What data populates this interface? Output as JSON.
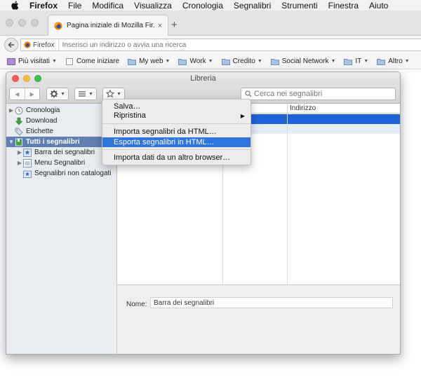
{
  "menubar": {
    "items": [
      "Firefox",
      "File",
      "Modifica",
      "Visualizza",
      "Cronologia",
      "Segnalibri",
      "Strumenti",
      "Finestra",
      "Aiuto"
    ]
  },
  "browser": {
    "tab_title": "Pagina iniziale di Mozilla Fir...",
    "tab_close": "×",
    "new_tab": "+",
    "identity_label": "Firefox",
    "url_placeholder": "Inserisci un indirizzo o avvia una ricerca"
  },
  "bookmarks_toolbar": {
    "items": [
      {
        "label": "Più visitati",
        "icon": "most-visited-icon",
        "dropdown": true
      },
      {
        "label": "Come iniziare",
        "icon": "page-icon",
        "dropdown": false
      },
      {
        "label": "My web",
        "icon": "folder-icon",
        "dropdown": true
      },
      {
        "label": "Work",
        "icon": "folder-icon",
        "dropdown": true
      },
      {
        "label": "Credito",
        "icon": "folder-icon",
        "dropdown": true
      },
      {
        "label": "Social Network",
        "icon": "folder-icon",
        "dropdown": true
      },
      {
        "label": "IT",
        "icon": "folder-icon",
        "dropdown": true
      },
      {
        "label": "Altro",
        "icon": "folder-icon",
        "dropdown": true
      }
    ]
  },
  "library": {
    "title": "Libreria",
    "search_placeholder": "Cerca nei segnalibri",
    "sidebar": {
      "items": [
        {
          "label": "Cronologia",
          "icon": "history-clock-icon",
          "twisty": "▶",
          "indent": 0
        },
        {
          "label": "Download",
          "icon": "download-arrow-icon",
          "twisty": "",
          "indent": 0
        },
        {
          "label": "Etichette",
          "icon": "tag-icon",
          "twisty": "",
          "indent": 0
        },
        {
          "label": "Tutti i segnalibri",
          "icon": "bookmark-folder-icon",
          "twisty": "▼",
          "indent": 0,
          "selected": true
        },
        {
          "label": "Barra dei segnalibri",
          "icon": "star-toolbar-icon",
          "twisty": "▶",
          "indent": 1
        },
        {
          "label": "Menu Segnalibri",
          "icon": "bookmarks-menu-icon",
          "twisty": "▶",
          "indent": 1
        },
        {
          "label": "Segnalibri non catalogati",
          "icon": "unsorted-bookmarks-icon",
          "twisty": "",
          "indent": 1
        }
      ]
    },
    "columns": {
      "address": "Indirizzo"
    },
    "details": {
      "name_label": "Nome:",
      "name_value": "Barra dei segnalibri"
    }
  },
  "dropdown_menu": {
    "items": [
      {
        "label": "Salva…",
        "submenu": false
      },
      {
        "label": "Ripristina",
        "submenu": true
      },
      {
        "label": "Importa segnalibri da HTML…",
        "submenu": false
      },
      {
        "label": "Esporta segnalibri in HTML…",
        "submenu": false,
        "highlighted": true
      },
      {
        "label": "Importa dati da un altro browser…",
        "submenu": false
      }
    ]
  },
  "colors": {
    "menu_highlight": "#2f75e0",
    "row_selection": "#1f63d6",
    "row_secondary": "#e3ecf9",
    "sidebar_selection": "#5e7fb3",
    "traffic_red": "#fc605c",
    "traffic_yellow": "#fdbc40",
    "traffic_green": "#34c84a",
    "firefox_orange": "#f57c00"
  }
}
